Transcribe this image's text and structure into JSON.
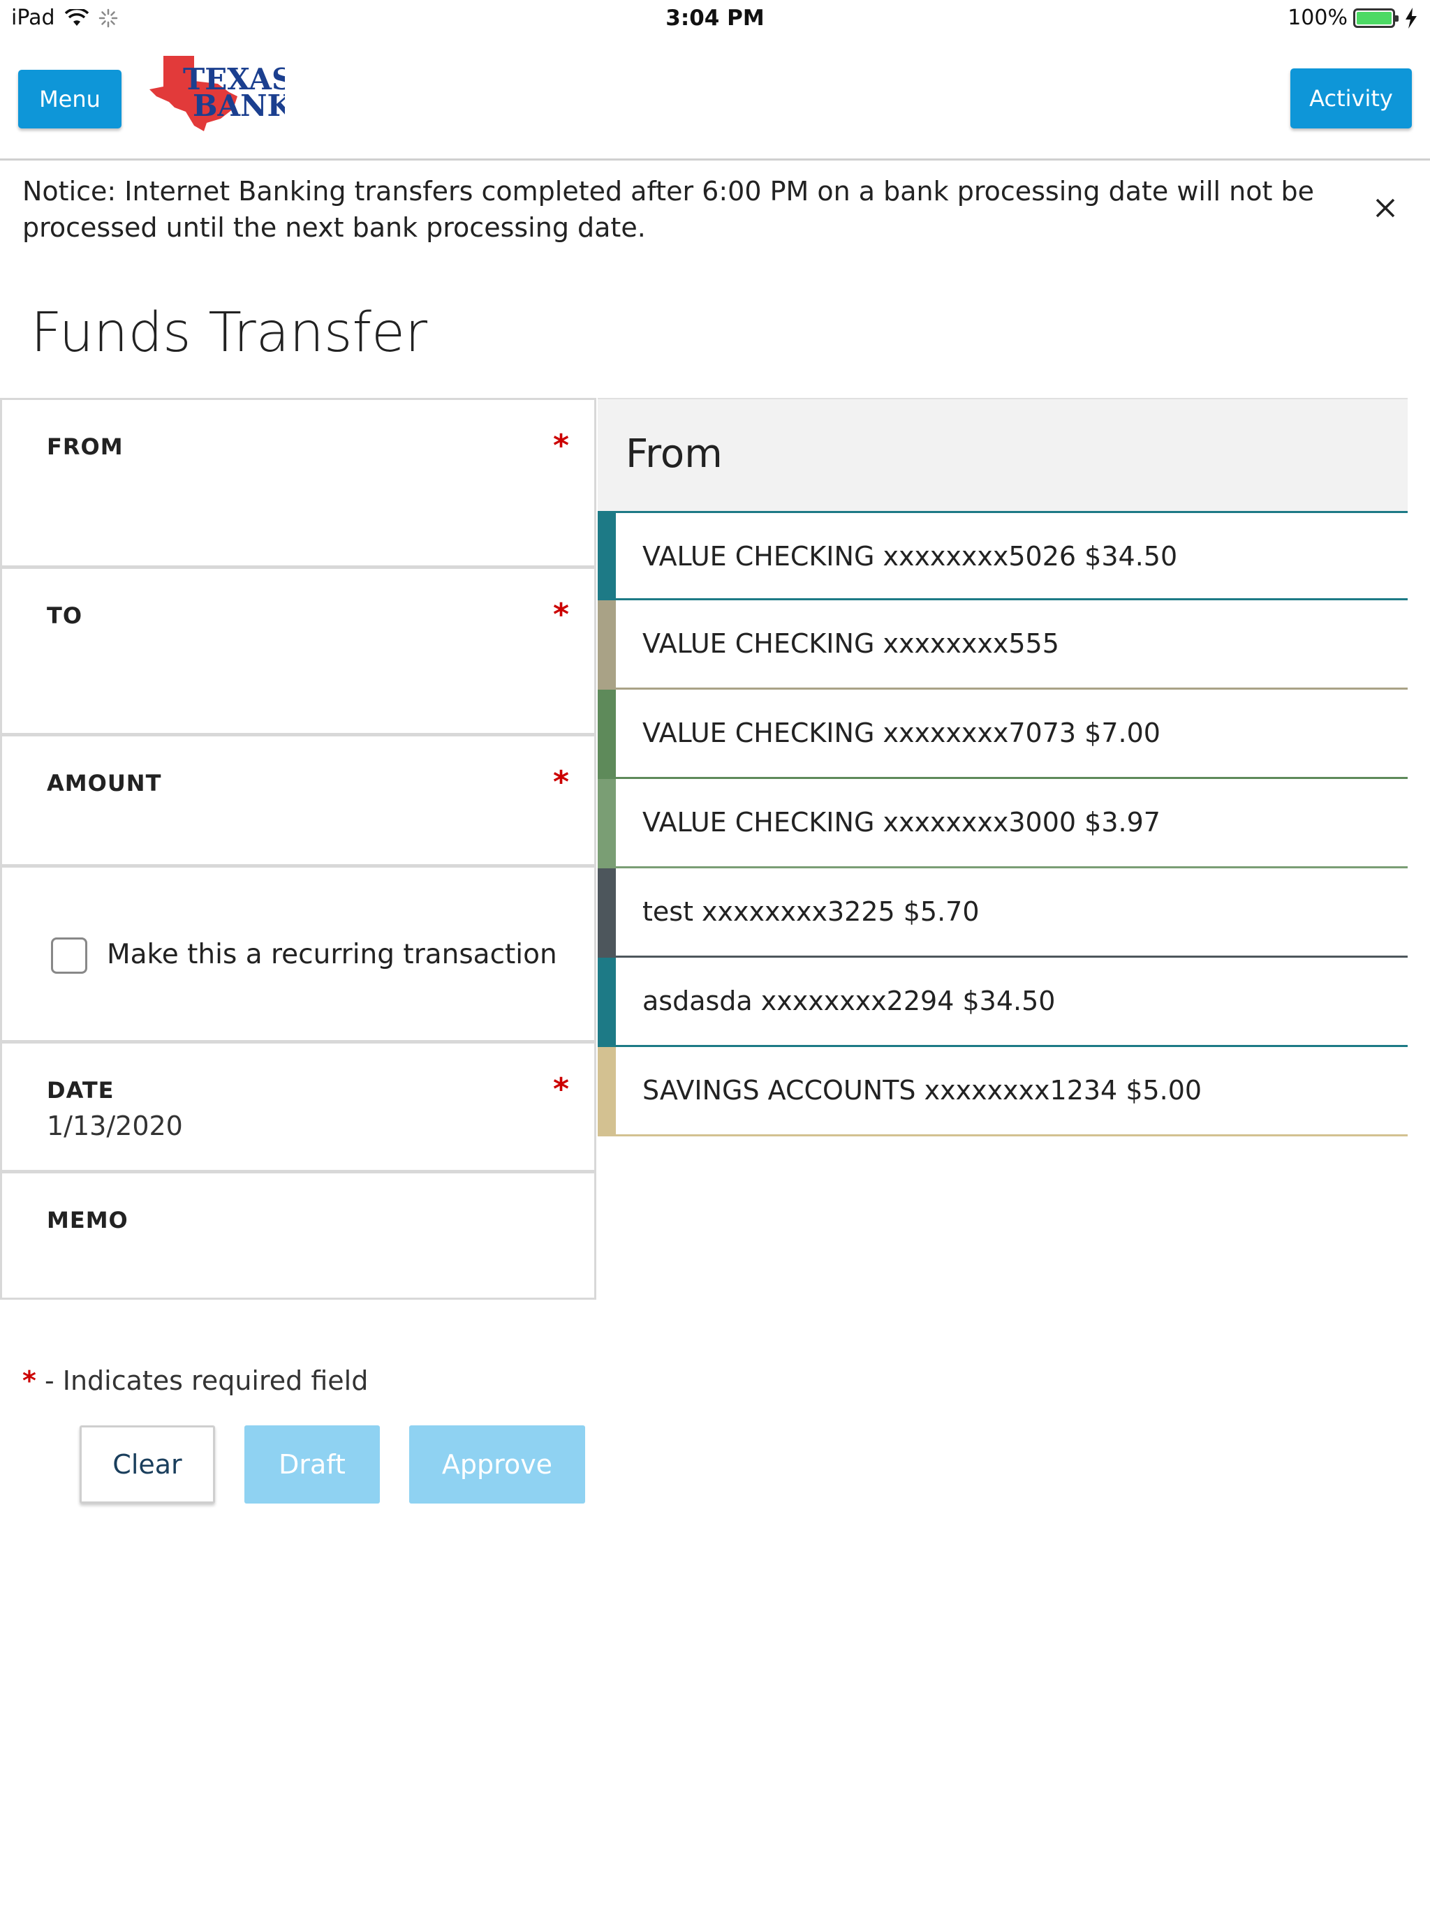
{
  "status_bar": {
    "device": "iPad",
    "time": "3:04 PM",
    "battery": "100%",
    "icons": [
      "wifi-icon",
      "activity-spinner-icon",
      "battery-icon",
      "charging-bolt-icon"
    ]
  },
  "header": {
    "menu_label": "Menu",
    "activity_label": "Activity",
    "logo_line1": "TEXAS",
    "logo_line2": "BANK",
    "accent_color": "#0e96d8"
  },
  "notice": {
    "text": "Notice: Internet Banking transfers completed after 6:00 PM on a bank processing date will not be processed until the next bank processing date."
  },
  "page": {
    "title": "Funds Transfer"
  },
  "form": {
    "from_label": "FROM",
    "to_label": "TO",
    "amount_label": "AMOUNT",
    "recurring_label": "Make this a recurring transaction",
    "recurring_checked": false,
    "date_label": "DATE",
    "date_value": "1/13/2020",
    "memo_label": "MEMO",
    "required_mark": "*"
  },
  "account_list": {
    "title": "From",
    "accounts": [
      {
        "label": "VALUE CHECKING xxxxxxxx5026 $34.50",
        "color": "#1d7a86"
      },
      {
        "label": "VALUE CHECKING xxxxxxxx555",
        "color": "#a9a286"
      },
      {
        "label": "VALUE CHECKING xxxxxxxx7073 $7.00",
        "color": "#5e8a5a"
      },
      {
        "label": "VALUE CHECKING xxxxxxxx3000 $3.97",
        "color": "#7a9e74"
      },
      {
        "label": "test xxxxxxxx3225 $5.70",
        "color": "#4d565c"
      },
      {
        "label": "asdasda xxxxxxxx2294 $34.50",
        "color": "#1d7a86"
      },
      {
        "label": "SAVINGS ACCOUNTS xxxxxxxx1234 $5.00",
        "color": "#d3c191"
      }
    ]
  },
  "footer": {
    "required_star": "*",
    "required_text": " - Indicates required field",
    "clear_label": "Clear",
    "draft_label": "Draft",
    "approve_label": "Approve"
  }
}
